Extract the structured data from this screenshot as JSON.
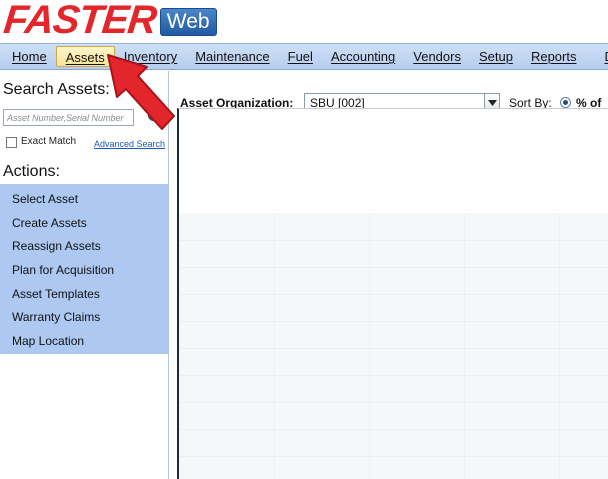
{
  "logo": {
    "faster": "FASTER",
    "web": "Web"
  },
  "nav": {
    "items": [
      {
        "label": "Home",
        "active": false
      },
      {
        "label": "Assets",
        "active": true
      },
      {
        "label": "Inventory",
        "active": false
      },
      {
        "label": "Maintenance",
        "active": false
      },
      {
        "label": "Fuel",
        "active": false
      },
      {
        "label": "Accounting",
        "active": false
      },
      {
        "label": "Vendors",
        "active": false
      },
      {
        "label": "Setup",
        "active": false
      },
      {
        "label": "Reports",
        "active": false
      },
      {
        "label": "D",
        "active": false
      }
    ]
  },
  "sidebar": {
    "search_title": "Search Assets:",
    "search_placeholder": "Asset Number,Serial Number",
    "exact_match_label": "Exact Match",
    "advanced_search_label": "Advanced Search",
    "actions_title": "Actions:",
    "actions": [
      {
        "label": "Select Asset"
      },
      {
        "label": "Create Assets"
      },
      {
        "label": "Reassign Assets"
      },
      {
        "label": "Plan for Acquisition"
      },
      {
        "label": "Asset Templates"
      },
      {
        "label": "Warranty Claims"
      },
      {
        "label": "Map Location"
      }
    ]
  },
  "main": {
    "org_label": "Asset Organization:",
    "org_value": "SBU [002]",
    "sort_label": "Sort By:",
    "sort_option": "% of"
  },
  "colors": {
    "logo_red": "#e3262b",
    "nav_bg": "#b6cdee",
    "active_tab": "#f7e39a",
    "actions_bg": "#adc9f2",
    "link_blue": "#1f55b4",
    "arrow_red": "#e3262b"
  },
  "icons": {
    "search": "magnifier-icon",
    "dropdown": "chevron-down-icon",
    "annotation": "red-arrow-pointer"
  }
}
